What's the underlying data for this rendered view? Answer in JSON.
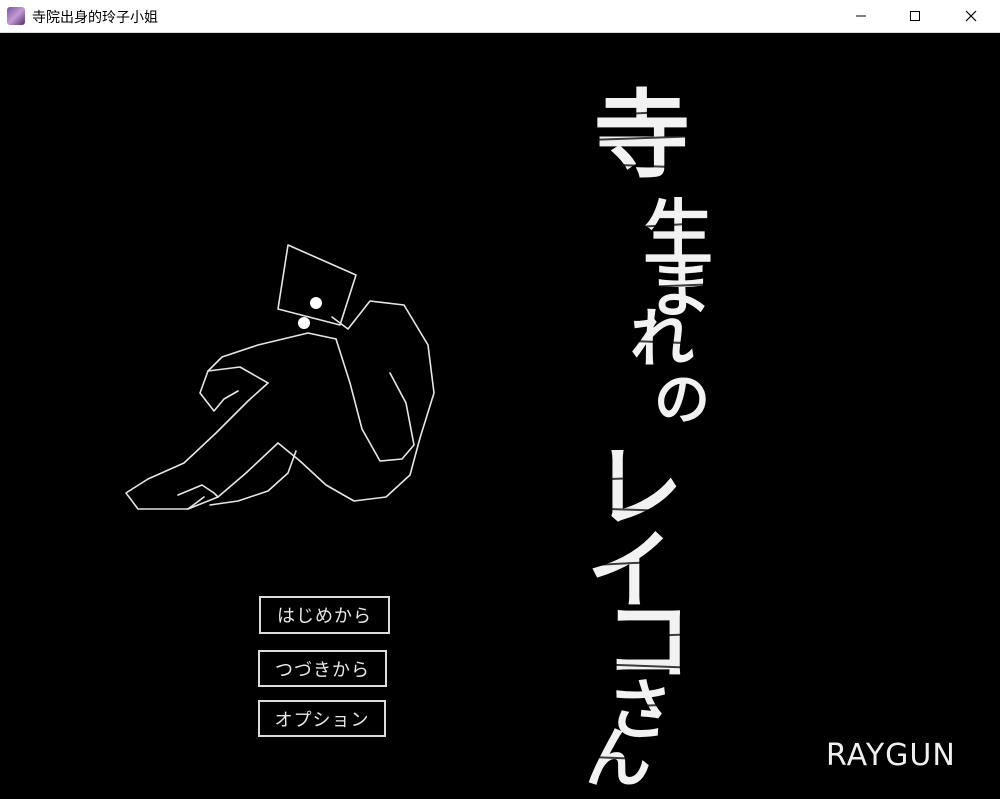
{
  "window": {
    "title": "寺院出身的玲子小姐",
    "icon": "app-icon",
    "controls": [
      "minimize-icon",
      "maximize-icon",
      "close-icon"
    ]
  },
  "logo": {
    "characters": [
      "寺",
      "生",
      "ま",
      "れ",
      "の",
      "レ",
      "イ",
      "コ",
      "さ",
      "ん"
    ]
  },
  "menu": {
    "new_game": "はじめから",
    "continue": "つづきから",
    "options": "オプション"
  },
  "developer": "RAYGUN",
  "colors": {
    "background": "#000000",
    "foreground": "#f0f0f0",
    "titlebar": "#ffffff"
  }
}
